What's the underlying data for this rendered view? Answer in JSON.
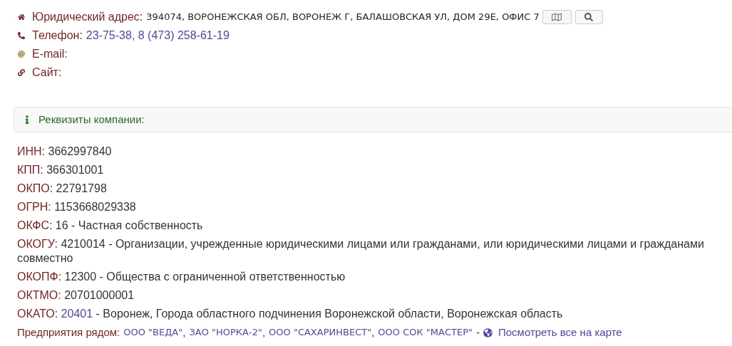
{
  "contacts": [
    {
      "kind": "address",
      "label": "Юридический адрес:",
      "value": "394074, ВОРОНЕЖСКАЯ ОБЛ, ВОРОНЕЖ Г, БАЛАШОВСКАЯ УЛ, ДОМ 29Е, ОФИС 7"
    },
    {
      "kind": "phone",
      "label": "Телефон:",
      "value": "23-75-38, 8 (473) 258-61-19"
    },
    {
      "kind": "email",
      "label": "E-mail:"
    },
    {
      "kind": "site",
      "label": "Сайт:"
    }
  ],
  "requisites_panel": {
    "title": "Реквизиты компании:"
  },
  "requisites": [
    {
      "label": "ИНН:",
      "value": "3662997840"
    },
    {
      "label": "КПП:",
      "value": "366301001"
    },
    {
      "label": "ОКПО:",
      "value": "22791798"
    },
    {
      "label": "ОГРН:",
      "value": "1153668029338"
    },
    {
      "label": "ОКФС:",
      "value": "16 - Частная собственность"
    },
    {
      "label": "ОКОГУ:",
      "value": "4210014 - Организации, учрежденные юридическими лицами или гражданами, или юридическими лицами и гражданами совместно"
    },
    {
      "label": "ОКОПФ:",
      "value": "12300 - Общества с ограниченной ответственностью"
    },
    {
      "label": "ОКТМО:",
      "value": "20701000001"
    },
    {
      "label": "ОКАТО:",
      "code": "20401",
      "value": "- Воронеж, Города областного подчинения Воронежской области, Воронежская область"
    }
  ],
  "nearby": {
    "label": "Предприятия рядом:",
    "separator": ",",
    "dash": "-",
    "companies": [
      "ООО \"ВЕДА\"",
      "ЗАО \"НОРКА-2\"",
      "ООО \"САХАРИНВЕСТ\"",
      "ООО СОК \"МАСТЕР\""
    ],
    "map_link": "Посмотреть все на карте"
  }
}
